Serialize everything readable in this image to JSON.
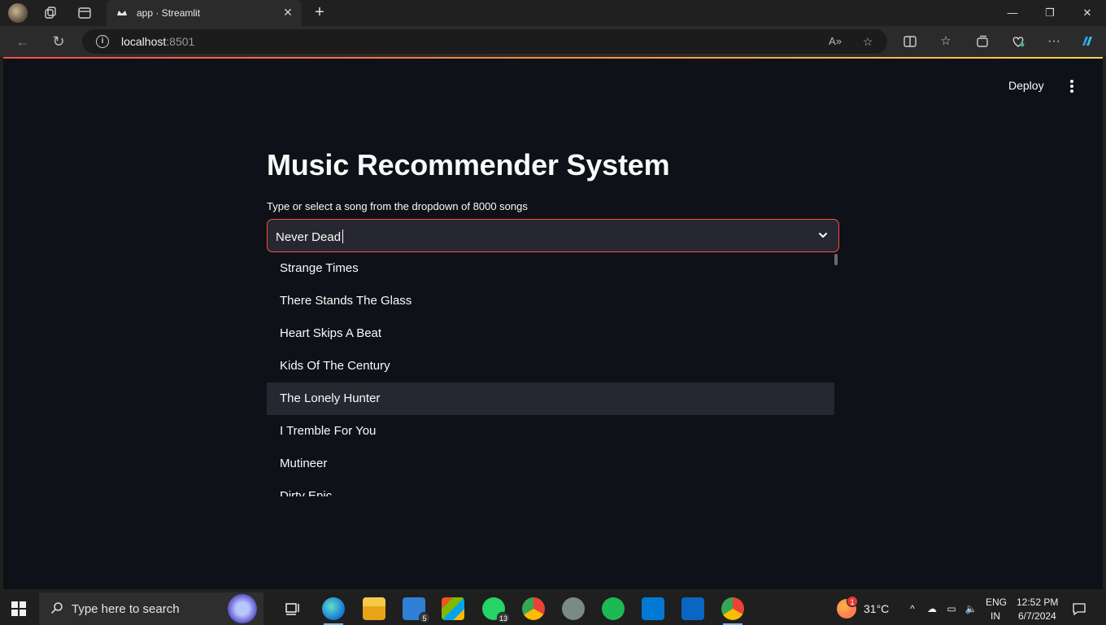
{
  "browser": {
    "tab_title": "app · Streamlit",
    "url_host": "localhost",
    "url_port": ":8501"
  },
  "app": {
    "deploy_label": "Deploy",
    "title": "Music Recommender System",
    "select_label": "Type or select a song from the dropdown of 8000 songs",
    "select_value": "Never Dead",
    "options": [
      "Strange Times",
      "There Stands The Glass",
      "Heart Skips A Beat",
      "Kids Of The Century",
      "The Lonely Hunter",
      "I Tremble For You",
      "Mutineer",
      "Dirty Epic"
    ],
    "highlighted_option": "The Lonely Hunter"
  },
  "taskbar": {
    "search_placeholder": "Type here to search",
    "mail_badge": "5",
    "whatsapp_badge": "13",
    "weather_badge": "1",
    "temperature": "31°C",
    "language": "ENG",
    "region": "IN",
    "time": "12:52 PM",
    "date": "6/7/2024"
  },
  "colors": {
    "app_background": "#0e1117",
    "accent": "#ff4b4b",
    "select_background": "#262730"
  }
}
